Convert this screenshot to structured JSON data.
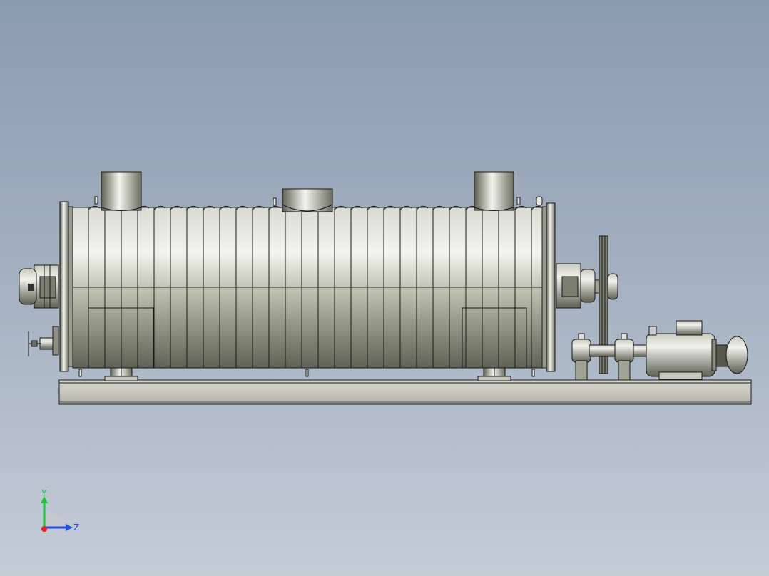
{
  "viewport": {
    "background_top": "#8b9bb0",
    "background_bottom": "#c4ccd6"
  },
  "model": {
    "name": "drum-dryer-assembly",
    "metal_light": "#f2f2ec",
    "metal_dark": "#5c5f52",
    "edge_color": "#1a1a1a"
  },
  "triad": {
    "y_label": "Y",
    "z_label": "Z",
    "y_color": "#20c040",
    "z_color": "#2050e0",
    "origin_color": "#e02020"
  }
}
